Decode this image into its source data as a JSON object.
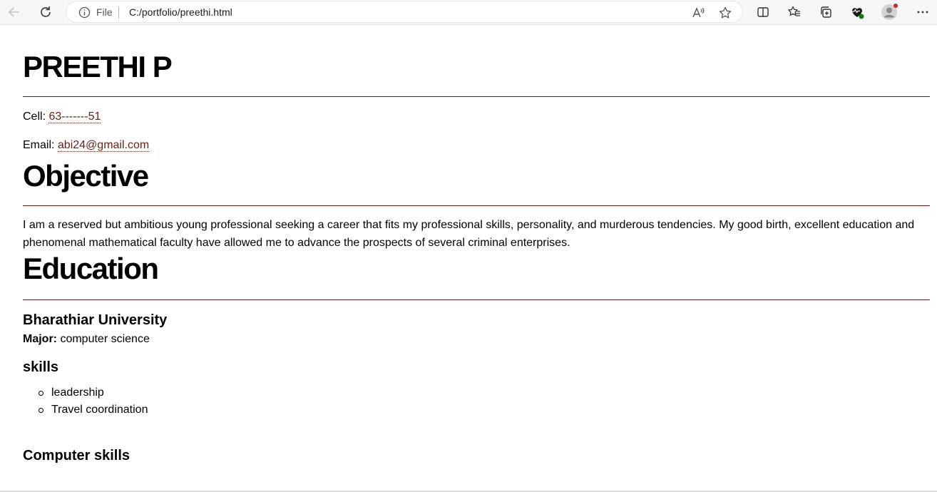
{
  "browser": {
    "scheme_label": "File",
    "url": "C:/portfolio/preethi.html",
    "colors": {
      "toolbar_bg": "#f7f7f7",
      "profile_dot": "#c42b1c",
      "health_dot": "#107c10"
    },
    "icons": [
      "back-arrow-icon",
      "refresh-icon",
      "info-icon",
      "read-aloud-icon",
      "favorite-star-icon",
      "split-screen-icon",
      "favorites-icon",
      "collections-icon",
      "health-icon",
      "profile-avatar-icon",
      "more-menu-icon"
    ]
  },
  "resume": {
    "name": "PREETHI P",
    "cell_label": "Cell:",
    "cell_value": "63-------51",
    "email_label": "Email:",
    "email_value": "abi24@gmail.com",
    "objective_heading": "Objective",
    "objective_line1": "I am a reserved but ambitious young professional seeking a career that fits my professional skills, personality, and murderous tendencies. My good birth, excellent education and",
    "objective_line2": "phenomenal mathematical faculty have allowed me to advance the prospects of several criminal enterprises.",
    "education_heading": "Education",
    "university": "Bharathiar University",
    "major_label": "Major:",
    "major_value": "computer science",
    "skills_heading": "skills",
    "skills": [
      "leadership",
      "Travel coordination"
    ],
    "computer_skills_heading": "Computer skills",
    "accent_color": "#6b1f12"
  }
}
